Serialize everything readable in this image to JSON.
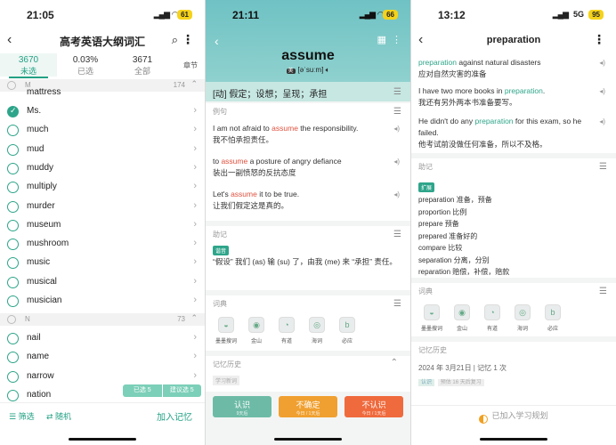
{
  "colors": {
    "accent": "#23a185",
    "highlight_red": "#e0523f",
    "know": "#6dbba6",
    "unsure": "#f0a030",
    "unknown": "#ef6a3d"
  },
  "p1": {
    "time": "21:05",
    "battery": "61",
    "title": "高考英语大纲词汇",
    "stats": [
      {
        "num": "3670",
        "label": "未选"
      },
      {
        "num": "0.03%",
        "label": "已选"
      },
      {
        "num": "3671",
        "label": "全部"
      }
    ],
    "chapter": "章节",
    "cut_word": "mattress",
    "section_m": {
      "letter": "M",
      "count": "174"
    },
    "words_m": [
      "Ms.",
      "much",
      "mud",
      "muddy",
      "multiply",
      "murder",
      "museum",
      "mushroom",
      "music",
      "musical",
      "musician"
    ],
    "section_n": {
      "letter": "N",
      "count": "73"
    },
    "words_n": [
      "nail",
      "name",
      "narrow",
      "nation"
    ],
    "selbar": [
      "已选 5",
      "建议选 5"
    ],
    "bottom": {
      "filter": "筛选",
      "random": "随机",
      "add": "加入记忆"
    }
  },
  "p2": {
    "time": "21:11",
    "battery": "66",
    "word": "assume",
    "phon_tag": "美",
    "phonetic": "[əˈsuːm]",
    "definition": "[动] 假定；设想；呈现；承担",
    "examples_title": "例句",
    "examples": [
      {
        "pre": "I am not afraid to ",
        "hl": "assume",
        "post": " the responsibility.",
        "zh": "我不怕承担责任。"
      },
      {
        "pre": "to ",
        "hl": "assume",
        "post": " a posture of angry defiance",
        "zh": "装出一副愤怒的反抗态度"
      },
      {
        "pre": "Let's ",
        "hl": "assume",
        "post": " it to be true.",
        "zh": "让我们假定这是真的。"
      }
    ],
    "mnemonic_title": "助记",
    "mnemonic_tag": "谐音",
    "mnemonic": "“假设” 我们 (as) 输 (su) 了，由我 (me) 来 “承担” 责任。",
    "dict_title": "词典",
    "dicts": [
      "墨墨搜词",
      "金山",
      "有道",
      "海词",
      "必应"
    ],
    "history_title": "记忆历史",
    "history_tag": "学习新词",
    "actions": [
      {
        "label": "认识",
        "sub": "9天后"
      },
      {
        "label": "不确定",
        "sub": "今日 / 1天后"
      },
      {
        "label": "不认识",
        "sub": "今日 / 1天后"
      }
    ]
  },
  "p3": {
    "time": "13:12",
    "network": "5G",
    "battery": "95",
    "title": "preparation",
    "examples": [
      {
        "pre": "",
        "hl": "preparation",
        "post": " against natural disasters",
        "zh": "应对自然灾害的准备"
      },
      {
        "pre": "I have two more books in ",
        "hl": "preparation",
        "post": ".",
        "zh": "我还有另外两本书准备要写。"
      },
      {
        "pre": "He didn't do any ",
        "hl": "preparation",
        "post": " for this exam, so he failed.",
        "zh": "他考试前没做任何准备，所以不及格。"
      }
    ],
    "mnemonic_title": "助记",
    "mnemonic_tag": "扩展",
    "expansion": [
      "preparation 准备，预备",
      "proportion 比例",
      "prepare 预备",
      "prepared 准备好的",
      "compare 比较",
      "separation 分离，分别",
      "reparation 赔偿，补偿，赔款"
    ],
    "dict_title": "词典",
    "dicts": [
      "墨墨搜词",
      "金山",
      "有道",
      "海词",
      "必应"
    ],
    "history_title": "记忆历史",
    "history_line": "2024 年 3月21日 | 记忆 1 次",
    "history_tags": [
      "认识",
      "预估 16 天后复习"
    ],
    "bottom": "已加入学习规划"
  }
}
